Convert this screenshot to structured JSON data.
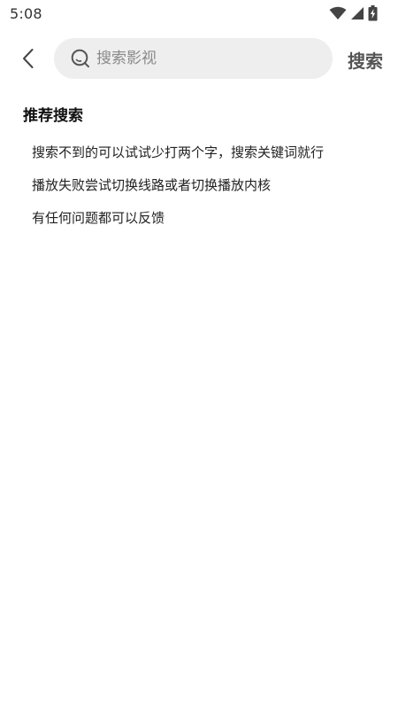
{
  "status_bar": {
    "time": "5:08",
    "icons": [
      "wifi-icon",
      "signal-icon",
      "battery-charging-icon"
    ]
  },
  "header": {
    "back_icon": "chevron-left-icon",
    "search_placeholder": "搜索影视",
    "search_value": "",
    "search_button_label": "搜索"
  },
  "recommend": {
    "title": "推荐搜索",
    "items": [
      "搜索不到的可以试试少打两个字，搜索关键词就行",
      "播放失败尝试切换线路或者切换播放内核",
      "有任何问题都可以反馈"
    ]
  },
  "colors": {
    "search_box_bg": "#eeeeee",
    "background": "#ffffff"
  }
}
